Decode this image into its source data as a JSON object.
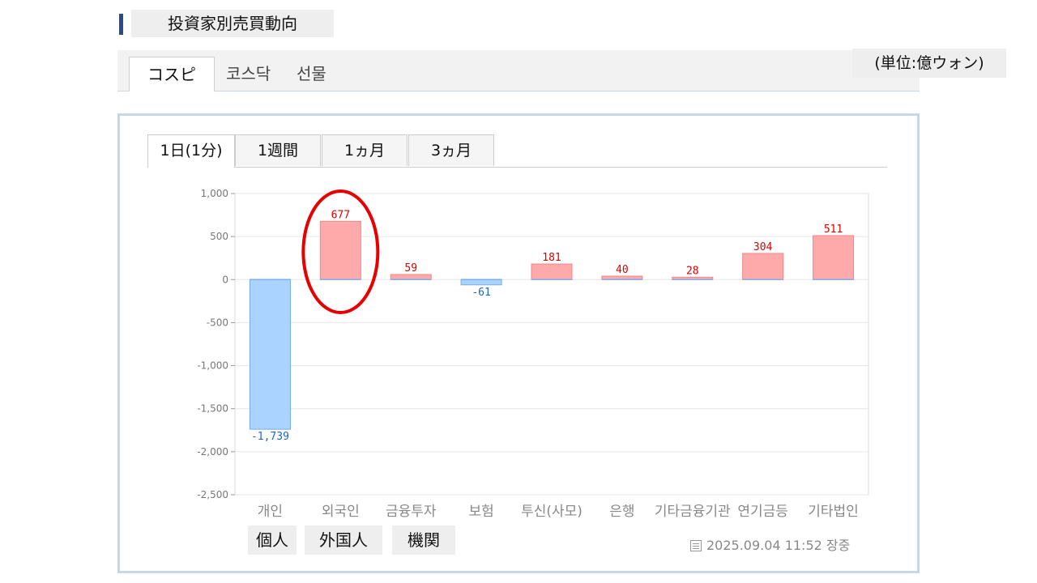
{
  "header": {
    "title": "投資家別売買動向"
  },
  "market_tabs": [
    {
      "label": "コスピ",
      "active": true
    },
    {
      "label": "코스닥",
      "active": false
    },
    {
      "label": "선물",
      "active": false
    }
  ],
  "unit_label": "(単位:億ウォン)",
  "period_tabs": [
    {
      "label": "1日(1分)",
      "active": true
    },
    {
      "label": "1週間",
      "active": false
    },
    {
      "label": "1ヵ月",
      "active": false
    },
    {
      "label": "3ヵ月",
      "active": false
    }
  ],
  "investor_labels": [
    "個人",
    "外国人",
    "機関"
  ],
  "timestamp": "2025.09.04 11:52 장중",
  "colors": {
    "positive": "#ffaaaa",
    "negative": "#aad4ff",
    "positive_text": "#dd0000",
    "negative_text": "#1a66cc",
    "highlight": "#e60000"
  },
  "chart_data": {
    "type": "bar",
    "categories": [
      "개인",
      "외국인",
      "금융투자",
      "보험",
      "투신(사모)",
      "은행",
      "기타금융",
      "기관",
      "연기금등",
      "기타법인"
    ],
    "category_labels": [
      "개인",
      "외국인",
      "금융투자",
      "보험",
      "투신(사모)",
      "은행",
      "기타금융기관",
      "연기금등",
      "기타법인"
    ],
    "values": [
      -1739,
      677,
      59,
      -61,
      181,
      40,
      28,
      304,
      511
    ],
    "data_labels": [
      "-1,739",
      "677",
      "59",
      "-61",
      "181",
      "40",
      "28",
      "304",
      "511"
    ],
    "ylim": [
      -2500,
      1000
    ],
    "yticks": [
      1000,
      500,
      0,
      -500,
      -1000,
      -1500,
      -2000,
      -2500
    ],
    "ytick_labels": [
      "1,000",
      "500",
      "0",
      "-500",
      "-1,000",
      "-1,500",
      "-2,000",
      "-2,500"
    ],
    "grid": true,
    "highlighted_category": "외국인"
  }
}
